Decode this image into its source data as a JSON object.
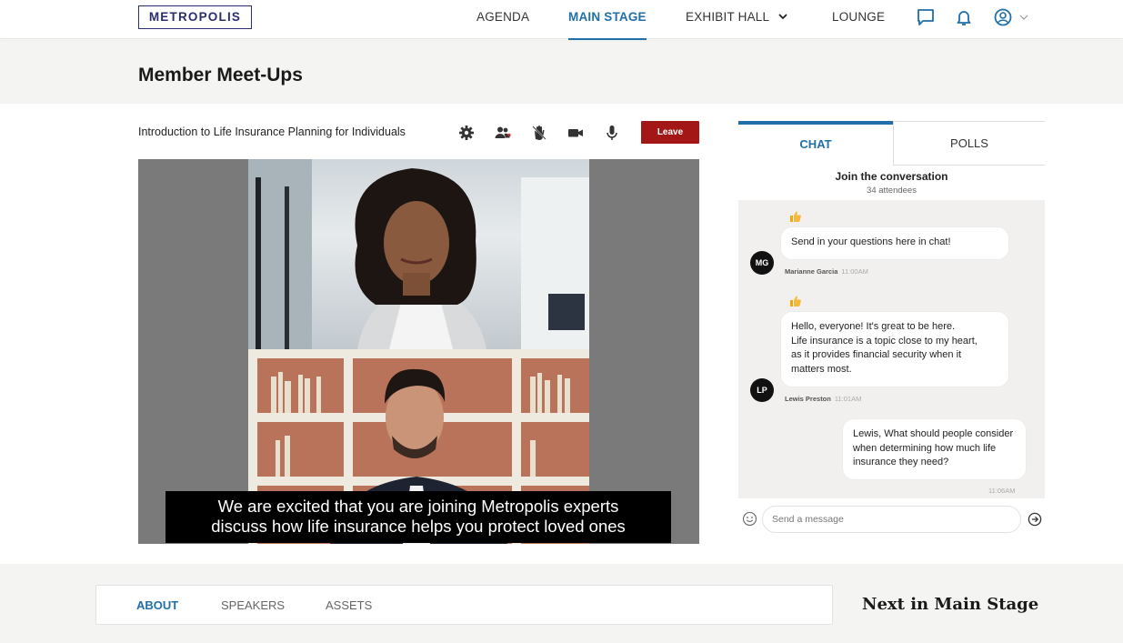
{
  "brand": {
    "logo": "METROPOLIS",
    "accent": "#1f6fa8",
    "leave_color": "#a31717"
  },
  "nav": {
    "items": [
      "AGENDA",
      "MAIN STAGE",
      "EXHIBIT HALL",
      "LOUNGE"
    ],
    "active": "MAIN STAGE",
    "icons": [
      "chat-icon",
      "bell-icon",
      "user-circle-icon",
      "chevron-down-icon"
    ]
  },
  "page": {
    "title": "Member Meet-Ups"
  },
  "session": {
    "title": "Introduction to Life Insurance Planning for Individuals",
    "toolbar_icons": [
      "gear-icon",
      "participants-icon",
      "raise-hand-icon",
      "camera-icon",
      "microphone-icon"
    ],
    "leave_label": "Leave"
  },
  "video": {
    "caption_line1": "We are excited that you are joining Metropolis experts",
    "caption_line2": "discuss how life insurance helps you protect loved ones"
  },
  "chat": {
    "tabs": [
      "CHAT",
      "POLLS"
    ],
    "active_tab": "CHAT",
    "heading": "Join the conversation",
    "attendees": "34 attendees",
    "messages": [
      {
        "initials": "MG",
        "text": "Send in your questions here in chat!",
        "name": "Marianne Garcia",
        "time": "11:00AM",
        "reaction": "thumbs-up-icon"
      },
      {
        "initials": "LP",
        "text_lines": [
          "Hello, everyone! It's great to be here.",
          "Life insurance is a topic close to my heart,",
          "as it provides financial security when it",
          "matters most."
        ],
        "name": "Lewis Preston",
        "time": "11:01AM",
        "reaction": "thumbs-up-icon"
      },
      {
        "self": true,
        "text_lines": [
          "Lewis, What should people consider",
          "when determining how much life",
          "insurance they need?"
        ],
        "time": "11:06AM"
      }
    ],
    "input_placeholder": "Send a message"
  },
  "info": {
    "tabs": [
      "ABOUT",
      "SPEAKERS",
      "ASSETS"
    ],
    "active_tab": "ABOUT",
    "next_heading": "Next in Main Stage"
  }
}
